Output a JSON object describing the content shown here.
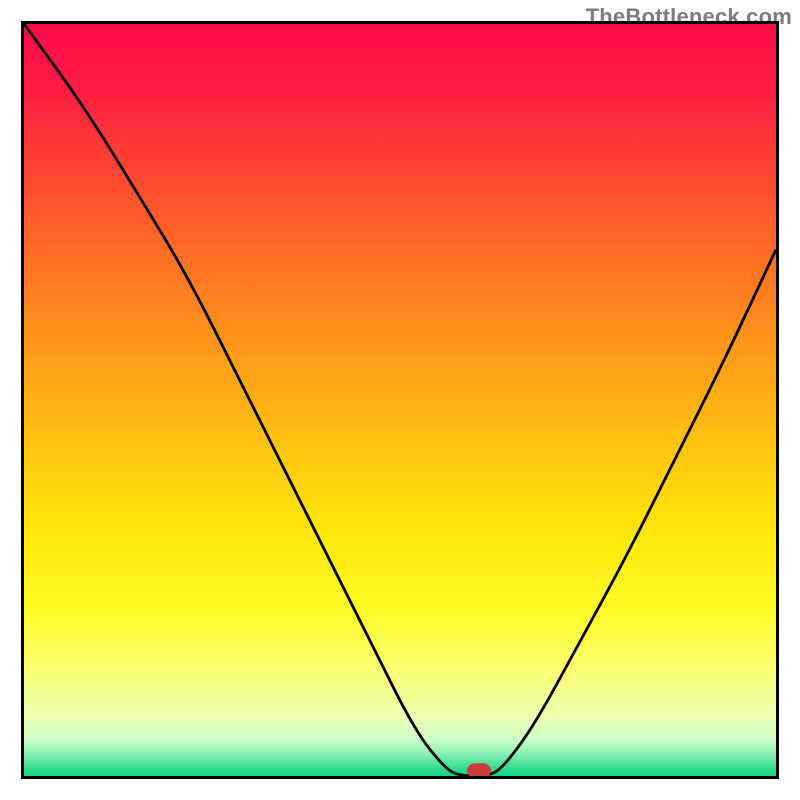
{
  "watermark": "TheBottleneck.com",
  "chart_data": {
    "type": "line",
    "title": "",
    "xlabel": "",
    "ylabel": "",
    "x_range": [
      0,
      100
    ],
    "y_range": [
      0,
      100
    ],
    "curve": [
      {
        "x": 0,
        "y": 100
      },
      {
        "x": 8,
        "y": 89
      },
      {
        "x": 16,
        "y": 76
      },
      {
        "x": 22,
        "y": 66
      },
      {
        "x": 30,
        "y": 50
      },
      {
        "x": 38,
        "y": 34
      },
      {
        "x": 46,
        "y": 18
      },
      {
        "x": 52,
        "y": 6
      },
      {
        "x": 56,
        "y": 1
      },
      {
        "x": 58,
        "y": 0
      },
      {
        "x": 62,
        "y": 0
      },
      {
        "x": 64,
        "y": 1.5
      },
      {
        "x": 68,
        "y": 7
      },
      {
        "x": 74,
        "y": 18
      },
      {
        "x": 80,
        "y": 29
      },
      {
        "x": 86,
        "y": 41
      },
      {
        "x": 93,
        "y": 55
      },
      {
        "x": 100,
        "y": 70
      }
    ],
    "marker": {
      "x": 60.5,
      "y": 0
    },
    "gradient_stops": [
      {
        "offset": 0,
        "color": "#ff0a4a"
      },
      {
        "offset": 8,
        "color": "#ff1b43"
      },
      {
        "offset": 18,
        "color": "#ff4034"
      },
      {
        "offset": 30,
        "color": "#ff6a25"
      },
      {
        "offset": 42,
        "color": "#ff941a"
      },
      {
        "offset": 55,
        "color": "#ffc010"
      },
      {
        "offset": 68,
        "color": "#ffe80a"
      },
      {
        "offset": 78,
        "color": "#fffb26"
      },
      {
        "offset": 86,
        "color": "#fbff72"
      },
      {
        "offset": 92,
        "color": "#ecffb0"
      },
      {
        "offset": 95,
        "color": "#cfffc8"
      },
      {
        "offset": 97,
        "color": "#8cf0b5"
      },
      {
        "offset": 99,
        "color": "#2fdc8e"
      },
      {
        "offset": 100,
        "color": "#15d486"
      }
    ]
  }
}
